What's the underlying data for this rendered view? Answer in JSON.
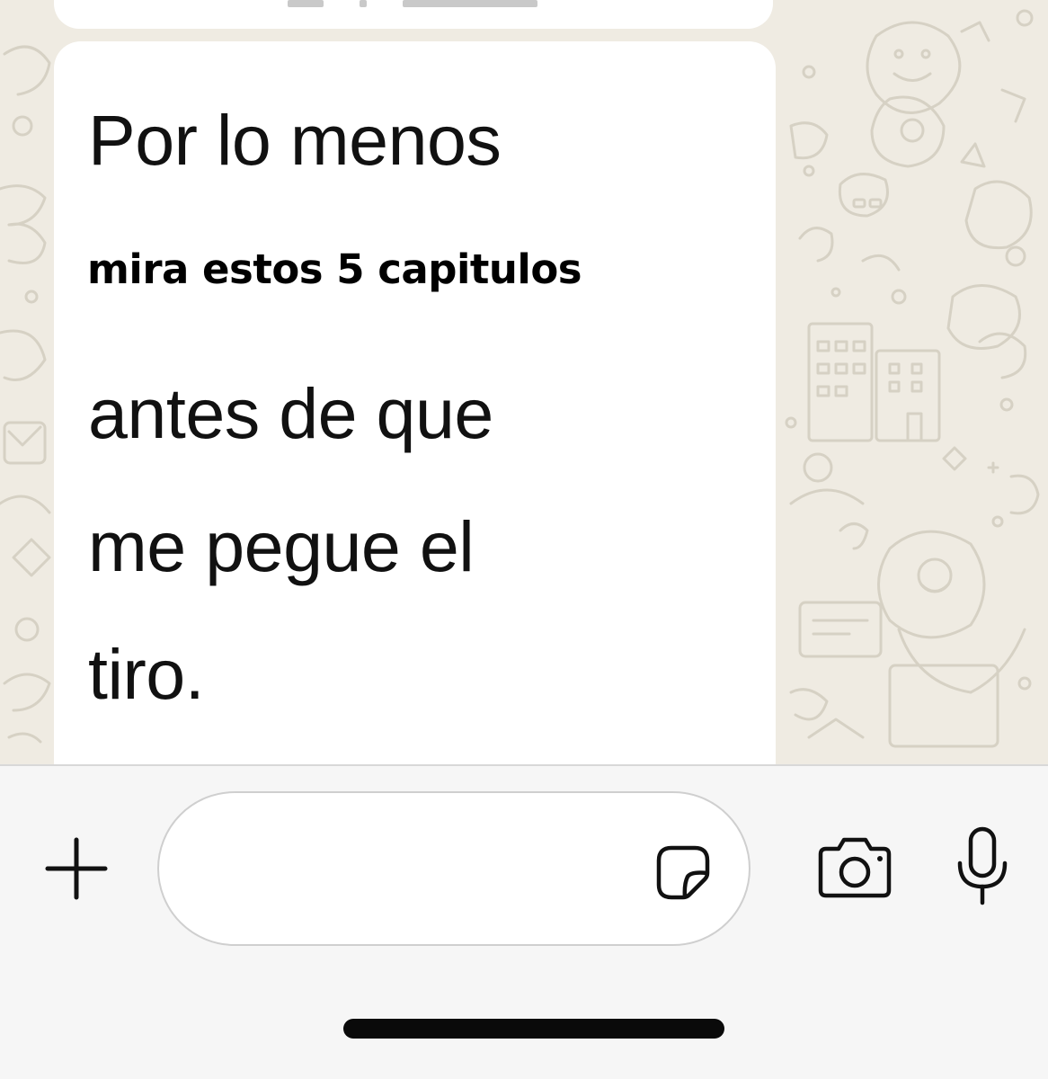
{
  "message": {
    "lines": [
      "Por lo menos",
      "antes de que",
      "me pegue el",
      "tiro."
    ]
  },
  "overlay_caption": "mira estos 5 capitulos",
  "composer": {
    "value": "",
    "placeholder": ""
  },
  "icons": {
    "plus": "plus-icon",
    "sticker": "sticker-icon",
    "camera": "camera-icon",
    "mic": "microphone-icon"
  },
  "colors": {
    "chat_background": "#efebe2",
    "bubble": "#ffffff",
    "input_bar": "#f6f6f6",
    "text": "#111111"
  }
}
